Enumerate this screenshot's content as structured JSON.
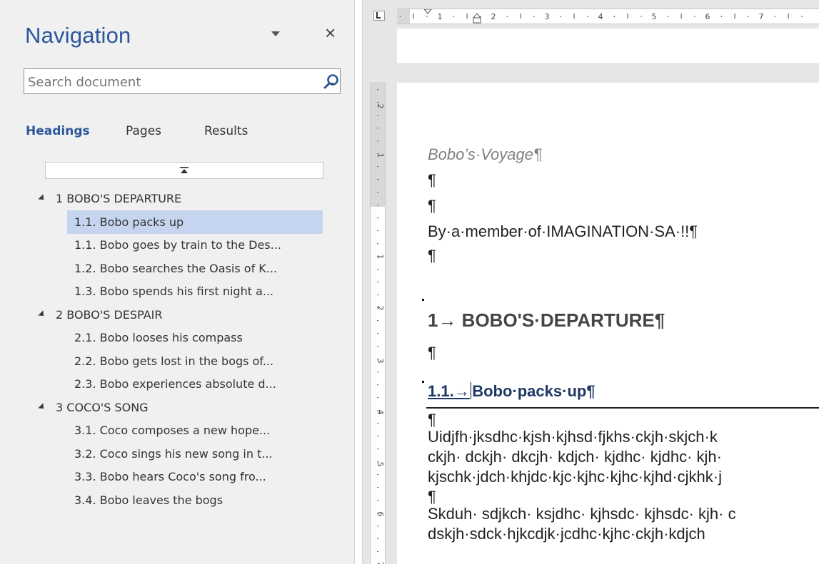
{
  "navigation": {
    "title": "Navigation",
    "close_glyph": "×",
    "search": {
      "placeholder": "Search document",
      "value": ""
    },
    "tabs": [
      "Headings",
      "Pages",
      "Results"
    ],
    "active_tab": "Headings",
    "headings": [
      {
        "level": 1,
        "text": "1 BOBO'S DEPARTURE"
      },
      {
        "level": 2,
        "text": "1.1. Bobo packs up",
        "selected": true
      },
      {
        "level": 2,
        "text": "1.1. Bobo goes by train to the Des..."
      },
      {
        "level": 2,
        "text": "1.2. Bobo searches the Oasis of K..."
      },
      {
        "level": 2,
        "text": "1.3. Bobo spends his first night a..."
      },
      {
        "level": 1,
        "text": "2 BOBO'S DESPAIR"
      },
      {
        "level": 2,
        "text": "2.1. Bobo looses his compass"
      },
      {
        "level": 2,
        "text": "2.2. Bobo gets lost in the bogs of..."
      },
      {
        "level": 2,
        "text": "2.3. Bobo experiences absolute d..."
      },
      {
        "level": 1,
        "text": "3 COCO'S SONG"
      },
      {
        "level": 2,
        "text": "3.1. Coco composes a new hope..."
      },
      {
        "level": 2,
        "text": "3.2. Coco sings his new song in t..."
      },
      {
        "level": 2,
        "text": "3.3. Bobo hears Coco's song fro..."
      },
      {
        "level": 2,
        "text": "3.4. Bobo leaves the bogs"
      }
    ]
  },
  "ruler": {
    "horizontal_numbers": [
      "1",
      "2",
      "3",
      "4",
      "5",
      "6",
      "7"
    ],
    "vertical_numbers": [
      "2",
      "1",
      "1",
      "2",
      "3",
      "4",
      "5",
      "6",
      "7"
    ]
  },
  "document": {
    "title": "Bobo’s·Voyage¶",
    "pilcrow": "¶",
    "author": "By·a·member·of·IMAGINATION·SA·!!¶",
    "heading1": "1→ BOBO'S·DEPARTURE¶",
    "heading2_number": "1.1.→",
    "heading2_text": "Bobo·packs·up¶",
    "body_lines": [
      "Uidjfh·jksdhc·kjsh·kjhsd·fjkhs·ckjh·skjch·k",
      "ckjh· dckjh· dkcjh· kdjch· kjdhc· kjdhc· kjh·",
      "kjschk·jdch·khjdc·kjc·kjhc·kjhc·kjhd·cjkhk·j",
      "Skduh· sdjkch· ksjdhc· kjhsdc· kjhsdc· kjh· c",
      "dskjh·sdck·hjkcdjk·jcdhc·kjhc·ckjh·kdjch"
    ]
  },
  "colors": {
    "accent": "#2b579a",
    "selection": "#c5d5ef",
    "heading2": "#1f3864"
  }
}
